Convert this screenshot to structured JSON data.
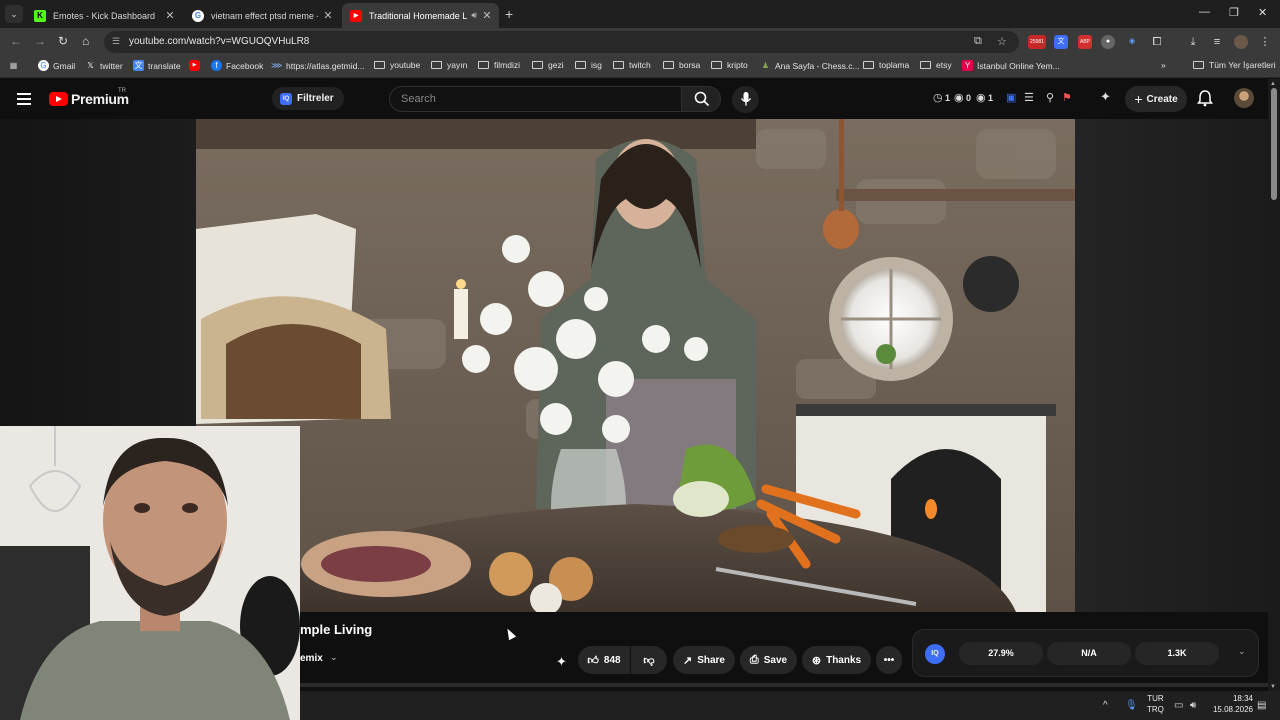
{
  "browser": {
    "tabs": [
      {
        "title": "Emotes - Kick Dashboard",
        "icon": "kick-icon",
        "active": false
      },
      {
        "title": "vietnam effect ptsd meme - Go",
        "icon": "google-icon",
        "active": false
      },
      {
        "title": "Traditional Homemade Las",
        "icon": "youtube-icon",
        "active": true,
        "audio": true
      }
    ],
    "url": "youtube.com/watch?v=WGUOQVHuLR8",
    "ext_badge": "25981",
    "bookmarks": [
      {
        "label": "Gmail",
        "icon": "google-icon"
      },
      {
        "label": "twitter",
        "icon": "x-icon"
      },
      {
        "label": "translate",
        "icon": "translate-icon"
      },
      {
        "label": "",
        "icon": "youtube-icon"
      },
      {
        "label": "Facebook",
        "icon": "facebook-icon"
      },
      {
        "label": "https://atlas.getmid...",
        "icon": "atlas-icon"
      },
      {
        "label": "youtube",
        "icon": "folder-icon"
      },
      {
        "label": "yayın",
        "icon": "folder-icon"
      },
      {
        "label": "filmdizi",
        "icon": "folder-icon"
      },
      {
        "label": "gezi",
        "icon": "folder-icon"
      },
      {
        "label": "isg",
        "icon": "folder-icon"
      },
      {
        "label": "twitch",
        "icon": "folder-icon"
      },
      {
        "label": "borsa",
        "icon": "folder-icon"
      },
      {
        "label": "kripto",
        "icon": "folder-icon"
      },
      {
        "label": "Ana Sayfa - Chess.c...",
        "icon": "chess-icon"
      },
      {
        "label": "toplama",
        "icon": "folder-icon"
      },
      {
        "label": "etsy",
        "icon": "folder-icon"
      },
      {
        "label": "İstanbul Online Yem...",
        "icon": "yemeksepeti-icon"
      }
    ],
    "all_bookmarks": "Tüm Yer İşaretleri"
  },
  "youtube": {
    "brand": "Premium",
    "region": "TR",
    "filter_label": "Filtreler",
    "search_placeholder": "Search",
    "stats": [
      "1",
      "0",
      "1"
    ],
    "create_label": "Create",
    "video_title": "mple Living",
    "channel": "emix",
    "likes": "848",
    "share": "Share",
    "save": "Save",
    "thanks": "Thanks",
    "metrics": [
      "27.9%",
      "N/A",
      "1.3K"
    ],
    "iq_logo": "IQ"
  },
  "taskbar": {
    "lang_top": "TUR",
    "lang_bottom": "TRQ",
    "time": "18:34",
    "date": "15.08.2026"
  },
  "colors": {
    "youtube_red": "#ff0000",
    "iq_blue": "#3d6ef5",
    "bg": "#0f0f0f"
  }
}
